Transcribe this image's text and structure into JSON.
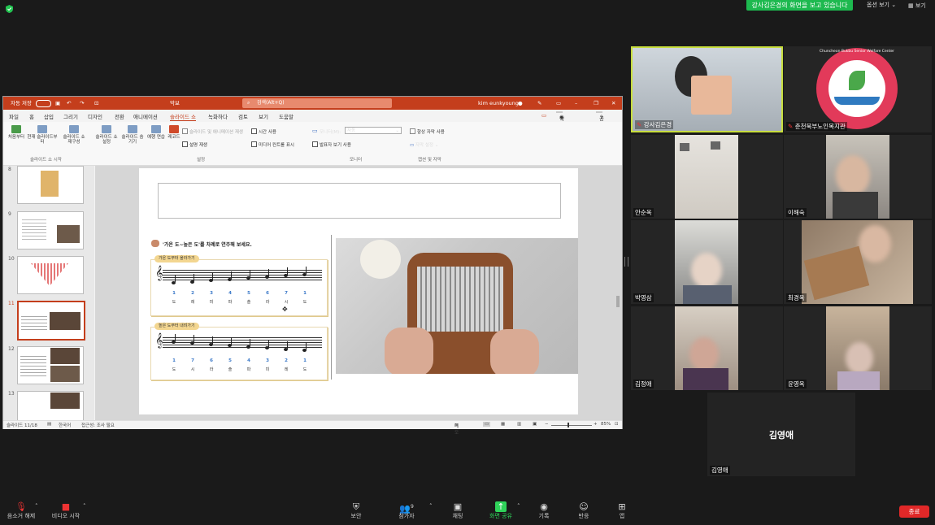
{
  "meeting": {
    "share_banner": "강사김은경의 화면을 보고 있습니다",
    "view_options": "옵션 보기",
    "view_label": "보기",
    "shield_color": "#23c552"
  },
  "ppt": {
    "autosave_label": "자동 저장",
    "doc_title": "악보",
    "search_placeholder": "검색(Alt+Q)",
    "user": "kim eunkyoung",
    "menu": [
      "파일",
      "홈",
      "삽입",
      "그리기",
      "디자인",
      "전환",
      "애니메이션",
      "슬라이드 쇼",
      "녹화하다",
      "검토",
      "보기",
      "도움말"
    ],
    "record_btn": "녹화하다",
    "share_btn": "공유",
    "ribbon": {
      "from_start": "처음부터",
      "current": "현재 슬라이드부터",
      "custom": "슬라이드 쇼 재구성",
      "setup": "슬라이드 쇼 설정",
      "hide": "슬라이드 숨기기",
      "rehearse": "예행 연습",
      "record": "레코드",
      "play_narr": "슬라이드 및 애니메이션 재생",
      "timing": "시간 사용",
      "narration": "설명 재생",
      "media_ctrl": "미디어 컨트롤 표시",
      "monitor_label": "모니터(M):",
      "monitor_value": "자동",
      "presenter_view": "발표자 보기 사용",
      "always_caption": "항상 자막 사용",
      "caption_settings": "자막 설정",
      "group_start": "슬라이드 쇼 시작",
      "group_setup": "설정",
      "group_monitor": "모니터",
      "group_caption": "캡션 및 자막"
    },
    "thumb_numbers": [
      "8",
      "9",
      "10",
      "11",
      "12",
      "13"
    ],
    "status": {
      "slide": "슬라이드 11/18",
      "lang": "한국어",
      "access": "접근성: 조사 필요",
      "notes": "메모",
      "zoom": "85%"
    },
    "slide": {
      "heading": "'가온 도~높은 도'를 차례로 연주해 보세요.",
      "up_tag": "가온 도부터 올라가기",
      "down_tag": "높은 도부터 내려가기",
      "up_nums": [
        "1",
        "2",
        "3",
        "4",
        "5",
        "6",
        "7",
        "1"
      ],
      "up_names": [
        "도",
        "레",
        "미",
        "파",
        "솔",
        "라",
        "시",
        "도"
      ],
      "down_nums": [
        "1",
        "7",
        "6",
        "5",
        "4",
        "3",
        "2",
        "1"
      ],
      "down_names": [
        "도",
        "시",
        "라",
        "솔",
        "파",
        "미",
        "레",
        "도"
      ]
    }
  },
  "participants": [
    {
      "name": "강사김은경"
    },
    {
      "name": "춘천북부노인복지관"
    },
    {
      "name": "안순옥"
    },
    {
      "name": "이해숙"
    },
    {
      "name": "박영삼"
    },
    {
      "name": "최경옥"
    },
    {
      "name": "김정애"
    },
    {
      "name": "윤영옥"
    },
    {
      "name": "김영애"
    }
  ],
  "logo_text": "Chuncheon Bukbu Senior Welfare Center",
  "toolbar": {
    "mute": "음소거 해제",
    "video": "비디오 시작",
    "security": "보안",
    "participants": "참가자",
    "participants_count": "9",
    "chat": "채팅",
    "share": "화면 공유",
    "record": "기록",
    "reactions": "반응",
    "apps": "앱",
    "end": "종료"
  }
}
